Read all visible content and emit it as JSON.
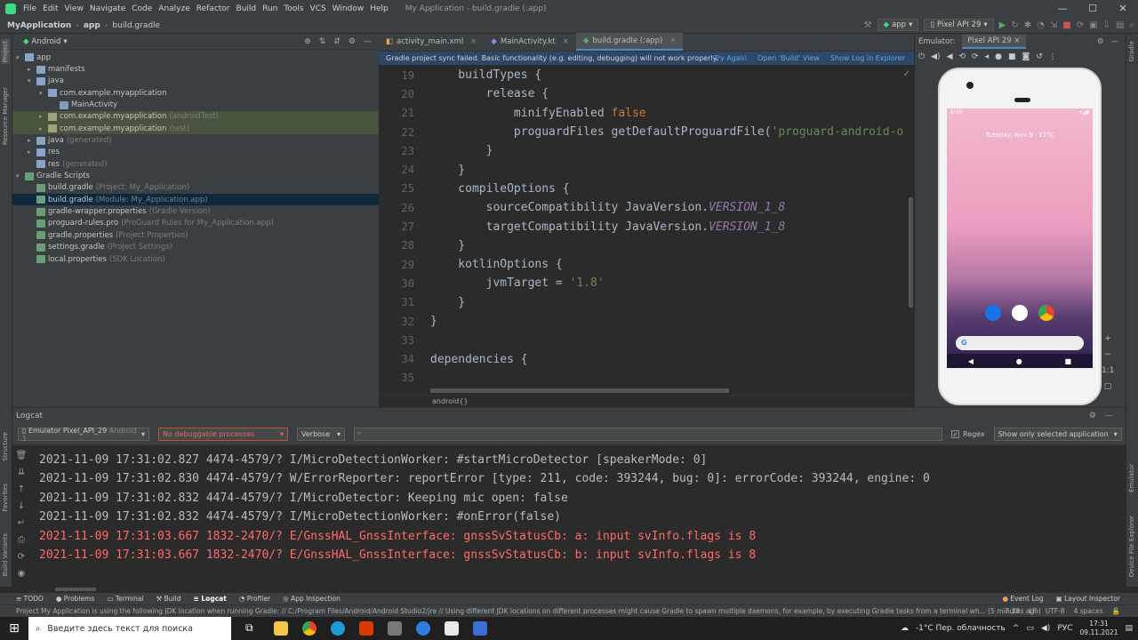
{
  "menubar": {
    "items": [
      "File",
      "Edit",
      "View",
      "Navigate",
      "Code",
      "Analyze",
      "Refactor",
      "Build",
      "Run",
      "Tools",
      "VCS",
      "Window",
      "Help"
    ],
    "window_title": "My Application - build.gradle (:app)"
  },
  "navbar": {
    "project": "MyApplication",
    "module": "app",
    "file": "build.gradle",
    "run_config": "app",
    "device": "Pixel API 29"
  },
  "left_strip": {
    "tabs": [
      "Project",
      "Resource Manager",
      "Structure",
      "Favorites",
      "Build Variants"
    ]
  },
  "project_panel": {
    "view_mode": "Android",
    "tree": [
      {
        "label": "app",
        "hint": "",
        "depth": 0,
        "arrow": "▾",
        "icon": "folder"
      },
      {
        "label": "manifests",
        "hint": "",
        "depth": 1,
        "arrow": "▸",
        "icon": "folder"
      },
      {
        "label": "java",
        "hint": "",
        "depth": 1,
        "arrow": "▾",
        "icon": "folder"
      },
      {
        "label": "com.example.myapplication",
        "hint": "",
        "depth": 2,
        "arrow": "▾",
        "icon": "folder"
      },
      {
        "label": "MainActivity",
        "hint": "",
        "depth": 3,
        "arrow": "",
        "icon": "file"
      },
      {
        "label": "com.example.myapplication",
        "hint": "(androidTest)",
        "depth": 2,
        "arrow": "▸",
        "icon": "folderg",
        "state": "tst"
      },
      {
        "label": "com.example.myapplication",
        "hint": "(test)",
        "depth": 2,
        "arrow": "▸",
        "icon": "folderg",
        "state": "tst"
      },
      {
        "label": "java",
        "hint": "(generated)",
        "depth": 1,
        "arrow": "▸",
        "icon": "folder"
      },
      {
        "label": "res",
        "hint": "",
        "depth": 1,
        "arrow": "▸",
        "icon": "folder"
      },
      {
        "label": "res",
        "hint": "(generated)",
        "depth": 1,
        "arrow": "",
        "icon": "folder"
      },
      {
        "label": "Gradle Scripts",
        "hint": "",
        "depth": 0,
        "arrow": "▾",
        "icon": "grad"
      },
      {
        "label": "build.gradle",
        "hint": "(Project: My_Application)",
        "depth": 1,
        "arrow": "",
        "icon": "grad"
      },
      {
        "label": "build.gradle",
        "hint": "(Module: My_Application.app)",
        "depth": 1,
        "arrow": "",
        "icon": "grad",
        "state": "sel"
      },
      {
        "label": "gradle-wrapper.properties",
        "hint": "(Gradle Version)",
        "depth": 1,
        "arrow": "",
        "icon": "grad"
      },
      {
        "label": "proguard-rules.pro",
        "hint": "(ProGuard Rules for My_Application.app)",
        "depth": 1,
        "arrow": "",
        "icon": "grad"
      },
      {
        "label": "gradle.properties",
        "hint": "(Project Properties)",
        "depth": 1,
        "arrow": "",
        "icon": "grad"
      },
      {
        "label": "settings.gradle",
        "hint": "(Project Settings)",
        "depth": 1,
        "arrow": "",
        "icon": "grad"
      },
      {
        "label": "local.properties",
        "hint": "(SDK Location)",
        "depth": 1,
        "arrow": "",
        "icon": "grad"
      }
    ]
  },
  "editor": {
    "tabs": [
      {
        "label": "activity_main.xml",
        "active": false
      },
      {
        "label": "MainActivity.kt",
        "active": false
      },
      {
        "label": "build.gradle (:app)",
        "active": true
      }
    ],
    "banner": {
      "message": "Gradle project sync failed. Basic functionality (e.g. editing, debugging) will not work properly.",
      "links": [
        "Try Again",
        "Open 'Build' View",
        "Show Log in Explorer"
      ]
    },
    "lines": [
      {
        "n": "19",
        "segs": [
          [
            "ct",
            "    buildTypes {"
          ]
        ]
      },
      {
        "n": "20",
        "segs": [
          [
            "ct",
            "        release {"
          ]
        ]
      },
      {
        "n": "21",
        "segs": [
          [
            "ct",
            "            minifyEnabled "
          ],
          [
            "kw",
            "false"
          ]
        ]
      },
      {
        "n": "22",
        "segs": [
          [
            "ct",
            "            proguardFiles getDefaultProguardFile("
          ],
          [
            "st",
            "'proguard-android-o"
          ]
        ]
      },
      {
        "n": "23",
        "segs": [
          [
            "ct",
            "        }"
          ]
        ]
      },
      {
        "n": "24",
        "segs": [
          [
            "ct",
            "    }"
          ]
        ]
      },
      {
        "n": "25",
        "segs": [
          [
            "ct",
            "    compileOptions {"
          ]
        ]
      },
      {
        "n": "26",
        "segs": [
          [
            "ct",
            "        sourceCompatibility JavaVersion."
          ],
          [
            "it",
            "VERSION_1_8"
          ]
        ]
      },
      {
        "n": "27",
        "segs": [
          [
            "ct",
            "        targetCompatibility JavaVersion."
          ],
          [
            "it",
            "VERSION_1_8"
          ]
        ]
      },
      {
        "n": "28",
        "segs": [
          [
            "ct",
            "    }"
          ]
        ]
      },
      {
        "n": "29",
        "segs": [
          [
            "ct",
            "    kotlinOptions {"
          ]
        ]
      },
      {
        "n": "30",
        "segs": [
          [
            "ct",
            "        jvmTarget = "
          ],
          [
            "st",
            "'1.8'"
          ]
        ]
      },
      {
        "n": "31",
        "segs": [
          [
            "ct",
            "    }"
          ]
        ]
      },
      {
        "n": "32",
        "segs": [
          [
            "ct",
            "}"
          ]
        ]
      },
      {
        "n": "33",
        "segs": [
          [
            "ct",
            ""
          ]
        ]
      },
      {
        "n": "34",
        "segs": [
          [
            "ct",
            "dependencies {"
          ]
        ]
      },
      {
        "n": "35",
        "segs": [
          [
            "ct",
            ""
          ]
        ]
      }
    ],
    "breadcrumb": "android{}"
  },
  "emulator": {
    "label": "Emulator:",
    "device_tab": "Pixel API 29",
    "status_time": "9:16",
    "date_line": "Tuesday, Nov 9  ·  17°C",
    "search_logo": "G"
  },
  "logcat": {
    "title": "Logcat",
    "device": "Emulator Pixel_API_29",
    "device_hint": "Android 1",
    "process": "No debuggable processes",
    "level": "Verbose",
    "search_placeholder": "",
    "regex_label": "Regex",
    "filter": "Show only selected application",
    "lines": [
      {
        "text": "2021-11-09 17:31:02.827 4474-4579/? I/MicroDetectionWorker: #startMicroDetector [speakerMode: 0]",
        "level": "info"
      },
      {
        "text": "2021-11-09 17:31:02.830 4474-4579/? W/ErrorReporter: reportError [type: 211, code: 393244, bug: 0]: errorCode: 393244, engine: 0",
        "level": "info"
      },
      {
        "text": "2021-11-09 17:31:02.832 4474-4579/? I/MicroDetector: Keeping mic open: false",
        "level": "info"
      },
      {
        "text": "2021-11-09 17:31:02.832 4474-4579/? I/MicroDetectionWorker: #onError(false)",
        "level": "info"
      },
      {
        "text": "2021-11-09 17:31:03.667 1832-2470/? E/GnssHAL_GnssInterface: gnssSvStatusCb: a: input svInfo.flags is 8",
        "level": "err"
      },
      {
        "text": "2021-11-09 17:31:03.667 1832-2470/? E/GnssHAL_GnssInterface: gnssSvStatusCb: b: input svInfo.flags is 8",
        "level": "err"
      }
    ]
  },
  "right_strip": {
    "tabs": [
      "Gradle",
      "Emulator",
      "Device File Explorer"
    ]
  },
  "bottom_tabs": {
    "left": [
      "TODO",
      "Problems",
      "Terminal",
      "Build",
      "Logcat",
      "Profiler",
      "App Inspection"
    ],
    "active": "Logcat",
    "right": [
      "Event Log",
      "Layout Inspector"
    ]
  },
  "statusbar": {
    "message": "Project My Application is using the following JDK location when running Gradle: // C:/Program Files/Android/Android Studio2/jre // Using different JDK locations on different processes might cause Gradle to spawn multiple daemons, for example, by executing Gradle tasks from a terminal wh... (5 minutes ago)",
    "position": "7:18",
    "line_sep": "LF",
    "encoding": "UTF-8",
    "indent": "4 spaces"
  },
  "taskbar": {
    "search_placeholder": "Введите здесь текст для поиска",
    "weather": "-1°C  Пер. облачность",
    "lang": "РУС",
    "time": "17:31",
    "date": "09.11.2021"
  }
}
